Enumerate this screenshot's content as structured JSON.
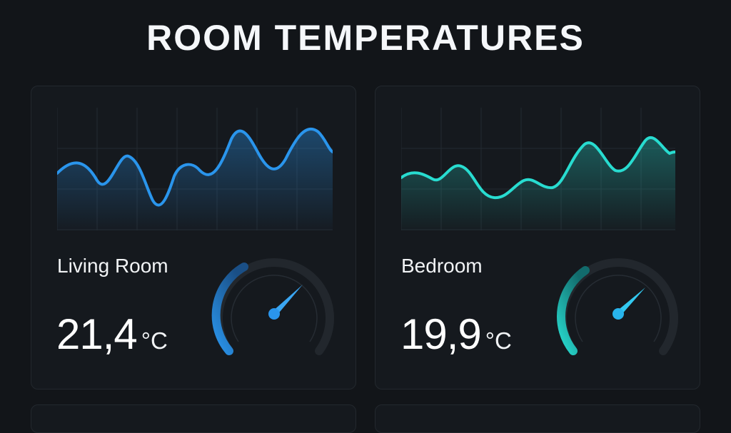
{
  "page": {
    "title": "ROOM TEMPERATURES"
  },
  "rooms": [
    {
      "name": "Living Room",
      "value": "21,4",
      "unit": "°C",
      "level": 0.35,
      "accent": "#2a95ec",
      "accent_dark": "#1764b4",
      "chart_data": {
        "type": "area",
        "y_trend": [
          0.42,
          0.52,
          0.3,
          0.68,
          0.18,
          0.55,
          0.4,
          0.78,
          0.52,
          0.82,
          0.64
        ],
        "grid": true
      }
    },
    {
      "name": "Bedroom",
      "value": "19,9",
      "unit": "°C",
      "level": 0.3,
      "accent": "#28dcd0",
      "accent_dark": "#109a96",
      "chart_data": {
        "type": "area",
        "y_trend": [
          0.45,
          0.4,
          0.55,
          0.3,
          0.42,
          0.38,
          0.72,
          0.5,
          0.78,
          0.63
        ],
        "grid": true
      }
    }
  ]
}
